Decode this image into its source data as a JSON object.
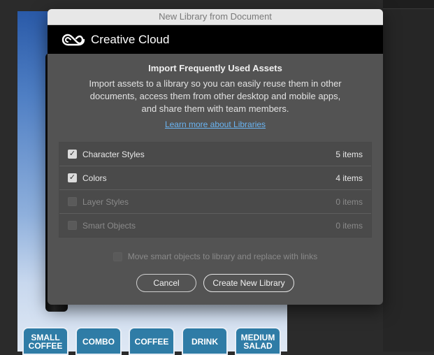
{
  "background": {
    "menu_buttons": [
      "SMALL\nCOFFEE",
      "COMBO",
      "COFFEE",
      "DRINK",
      "MEDIUM\nSALAD"
    ]
  },
  "dialog": {
    "window_title": "New Library from Document",
    "brand": "Creative Cloud",
    "heading": "Import Frequently Used Assets",
    "description": "Import assets to a library so you can easily reuse them in other\ndocuments, access them from other desktop and mobile apps,\nand share them with team members.",
    "learn_more_link": "Learn more about Libraries",
    "assets": [
      {
        "name": "Character Styles",
        "count": "5 items",
        "checked": true,
        "enabled": true
      },
      {
        "name": "Colors",
        "count": "4 items",
        "checked": true,
        "enabled": true
      },
      {
        "name": "Layer Styles",
        "count": "0 items",
        "checked": false,
        "enabled": false
      },
      {
        "name": "Smart Objects",
        "count": "0 items",
        "checked": false,
        "enabled": false
      }
    ],
    "smart_objects_option": "Move smart objects to library and replace with links",
    "cancel_label": "Cancel",
    "create_label": "Create New Library"
  },
  "colors": {
    "dialog_bg": "#535353",
    "link": "#6ab4f2",
    "menu_button": "#2f7ca6"
  }
}
